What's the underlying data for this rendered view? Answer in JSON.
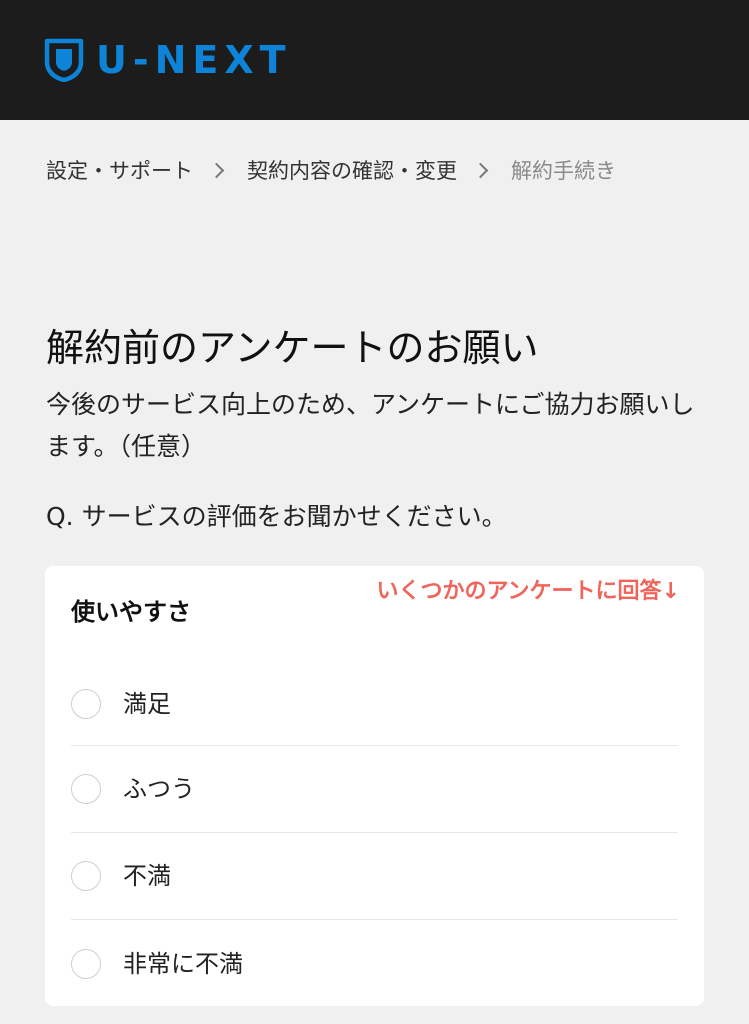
{
  "header": {
    "logo_text": "U-NEXT",
    "logo_icon": "shield-logo-icon",
    "brand_color": "#0d84d8",
    "background_color": "#1c1c1c"
  },
  "breadcrumb": {
    "items": [
      {
        "label": "設定・サポート"
      },
      {
        "label": "契約内容の確認・変更"
      },
      {
        "label": "解約手続き"
      }
    ],
    "separator_icon": "chevron-right-icon"
  },
  "main": {
    "title": "解約前のアンケートのお願い",
    "description": "今後のサービス向上のため、アンケートにご協力お願いします。（任意）",
    "question": "Q. サービスの評価をお聞かせください。"
  },
  "survey_card": {
    "annotation": "いくつかのアンケートに回答↓",
    "annotation_color": "#f0645a",
    "title": "使いやすさ",
    "options": [
      {
        "label": "満足"
      },
      {
        "label": "ふつう"
      },
      {
        "label": "不満"
      },
      {
        "label": "非常に不満"
      }
    ]
  }
}
